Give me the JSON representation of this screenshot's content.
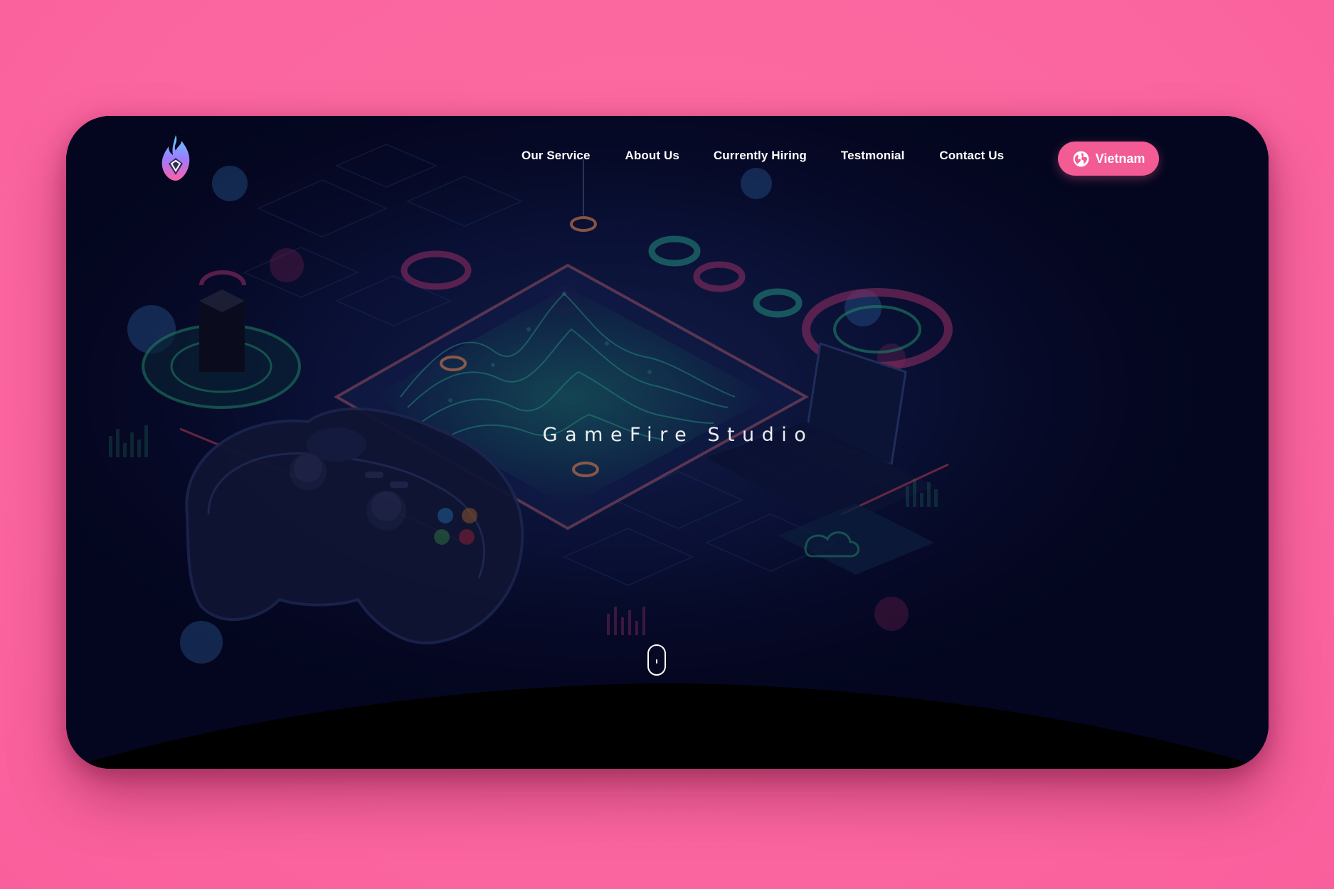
{
  "nav": {
    "items": [
      {
        "label": "Our Service"
      },
      {
        "label": "About Us"
      },
      {
        "label": "Currently Hiring"
      },
      {
        "label": "Testmonial"
      },
      {
        "label": "Contact Us"
      }
    ]
  },
  "language_button": {
    "label": "Vietnam",
    "icon": "globe-icon"
  },
  "hero": {
    "title": "GameFire Studio"
  },
  "brand": {
    "logo_icon": "flame-logo-icon"
  },
  "scroll_indicator": {
    "icon": "mouse-scroll-icon"
  },
  "colors": {
    "page_background": "#fc69a1",
    "card_background": "#05061f",
    "accent_pink": "#f35b95",
    "text": "#ffffff"
  }
}
